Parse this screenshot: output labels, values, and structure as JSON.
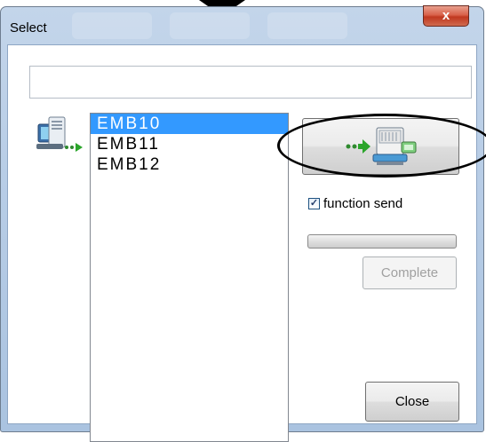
{
  "window": {
    "title": "Select",
    "close_glyph": "x"
  },
  "path_field": {
    "value": ""
  },
  "list": {
    "items": [
      "EMB10",
      "EMB11",
      "EMB12"
    ],
    "selected": "EMB10"
  },
  "send_button": {
    "icon": "send-to-embroidery-machine-icon"
  },
  "function_send": {
    "label": "function send",
    "checked": true
  },
  "progress": {
    "value": 0
  },
  "complete_button": {
    "label": "Complete",
    "enabled": false
  },
  "close_button": {
    "label": "Close"
  },
  "colors": {
    "selection": "#3399ff",
    "frame": "#b8cde6",
    "close_red": "#c0381f"
  }
}
